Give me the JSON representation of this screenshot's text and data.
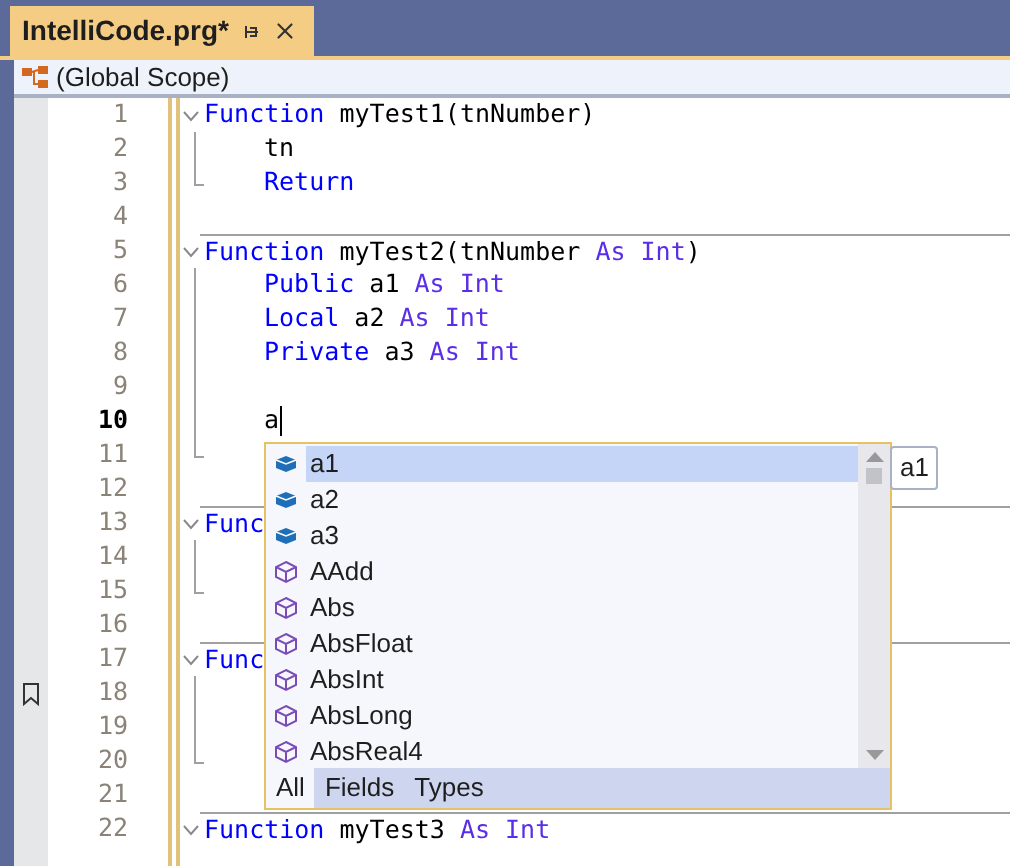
{
  "tab": {
    "title": "IntelliCode.prg*",
    "selected": true
  },
  "scope": {
    "label": "(Global Scope)"
  },
  "lines": [
    {
      "number": "1",
      "kind": "header",
      "separator": false,
      "tokens": [
        {
          "text": "Function",
          "kind": "keyword"
        },
        {
          "text": " myTest1(tnNumber)",
          "kind": "plain"
        }
      ]
    },
    {
      "number": "2",
      "kind": "body",
      "separator": false,
      "indent": true,
      "tokens": [
        {
          "text": "tn",
          "kind": "plain"
        }
      ]
    },
    {
      "number": "3",
      "kind": "end",
      "separator": false,
      "indent": true,
      "tokens": [
        {
          "text": "Return",
          "kind": "keyword"
        }
      ]
    },
    {
      "number": "4",
      "kind": "plain",
      "separator": false
    },
    {
      "number": "5",
      "kind": "header",
      "separator": true,
      "tokens": [
        {
          "text": "Function",
          "kind": "keyword"
        },
        {
          "text": " myTest2(tnNumber ",
          "kind": "plain"
        },
        {
          "text": "As Int",
          "kind": "type"
        },
        {
          "text": ")",
          "kind": "plain"
        }
      ]
    },
    {
      "number": "6",
      "kind": "body",
      "separator": false,
      "indent": true,
      "tokens": [
        {
          "text": "Public",
          "kind": "keyword"
        },
        {
          "text": " a1 ",
          "kind": "plain"
        },
        {
          "text": "As Int",
          "kind": "type"
        }
      ]
    },
    {
      "number": "7",
      "kind": "body",
      "separator": false,
      "indent": true,
      "tokens": [
        {
          "text": "Local",
          "kind": "keyword"
        },
        {
          "text": " a2 ",
          "kind": "plain"
        },
        {
          "text": "As Int",
          "kind": "type"
        }
      ]
    },
    {
      "number": "8",
      "kind": "body",
      "separator": false,
      "indent": true,
      "tokens": [
        {
          "text": "Private",
          "kind": "keyword"
        },
        {
          "text": " a3 ",
          "kind": "plain"
        },
        {
          "text": "As Int",
          "kind": "type"
        }
      ]
    },
    {
      "number": "9",
      "kind": "body",
      "separator": false
    },
    {
      "number": "10",
      "kind": "body",
      "separator": false,
      "current": true,
      "indent": true,
      "tokens": [
        {
          "text": "a",
          "kind": "plain"
        }
      ]
    },
    {
      "number": "11",
      "kind": "end",
      "separator": false
    },
    {
      "number": "12",
      "kind": "plain",
      "separator": false
    },
    {
      "number": "13",
      "kind": "header",
      "separator": true,
      "tokens": [
        {
          "text": "Func",
          "kind": "keyword"
        }
      ]
    },
    {
      "number": "14",
      "kind": "body",
      "separator": false
    },
    {
      "number": "15",
      "kind": "end",
      "separator": false
    },
    {
      "number": "16",
      "kind": "plain",
      "separator": false
    },
    {
      "number": "17",
      "kind": "header",
      "separator": true,
      "tokens": [
        {
          "text": "Func",
          "kind": "keyword"
        }
      ]
    },
    {
      "number": "18",
      "kind": "body",
      "separator": false,
      "bookmark": true
    },
    {
      "number": "19",
      "kind": "body",
      "separator": false
    },
    {
      "number": "20",
      "kind": "end",
      "separator": false
    },
    {
      "number": "21",
      "kind": "plain",
      "separator": false
    },
    {
      "number": "22",
      "kind": "header",
      "separator": true,
      "tokens": [
        {
          "text": "Function",
          "kind": "keyword"
        },
        {
          "text": " myTest3 ",
          "kind": "plain"
        },
        {
          "text": "As Int",
          "kind": "type"
        }
      ]
    }
  ],
  "completion": {
    "items": [
      {
        "label": "a1",
        "kind": "variable",
        "selected": true
      },
      {
        "label": "a2",
        "kind": "variable",
        "selected": false
      },
      {
        "label": "a3",
        "kind": "variable",
        "selected": false
      },
      {
        "label": "AAdd",
        "kind": "function",
        "selected": false
      },
      {
        "label": "Abs",
        "kind": "function",
        "selected": false
      },
      {
        "label": "AbsFloat",
        "kind": "function",
        "selected": false
      },
      {
        "label": "AbsInt",
        "kind": "function",
        "selected": false
      },
      {
        "label": "AbsLong",
        "kind": "function",
        "selected": false
      },
      {
        "label": "AbsReal4",
        "kind": "function",
        "selected": false
      }
    ],
    "filters": [
      {
        "label": "All",
        "selected": true
      },
      {
        "label": "Fields",
        "selected": false
      },
      {
        "label": "Types",
        "selected": false
      }
    ],
    "tooltip": "a1"
  }
}
